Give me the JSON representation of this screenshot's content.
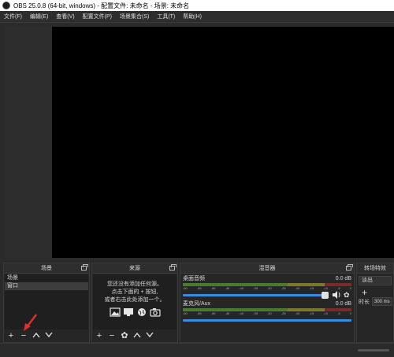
{
  "window": {
    "title": "OBS 25.0.8 (64-bit, windows) - 配置文件: 未命名 - 场景: 未命名"
  },
  "menu": [
    "文件(F)",
    "编辑(E)",
    "查看(V)",
    "配置文件(P)",
    "场景集合(S)",
    "工具(T)",
    "帮助(H)"
  ],
  "scenes": {
    "title": "场景",
    "items": [
      "场景",
      "窗口"
    ],
    "selected_index": 1
  },
  "sources": {
    "title": "来源",
    "hint": [
      "您还没有添加任何源。",
      "点击下面的 + 按钮,",
      "或者右击此处添加一个。"
    ]
  },
  "mixer": {
    "title": "混音器",
    "channels": [
      {
        "name": "桌面音频",
        "db": "0.0 dB"
      },
      {
        "name": "麦克风/Aux",
        "db": "0.0 dB"
      }
    ],
    "ticks": [
      "-60",
      "-55",
      "-50",
      "-45",
      "-40",
      "-35",
      "-30",
      "-25",
      "-20",
      "-15",
      "-10",
      "-5",
      "0"
    ]
  },
  "transitions": {
    "title": "转场特效",
    "selected": "淡出",
    "duration_label": "时长",
    "duration_value": "300 ms"
  },
  "colors": {
    "accent": "#3a8ce0",
    "arrow": "#e03030"
  },
  "icons": [
    "add-icon",
    "remove-icon",
    "up-icon",
    "down-icon",
    "settings-icon",
    "speaker-icon",
    "gear-icon"
  ]
}
